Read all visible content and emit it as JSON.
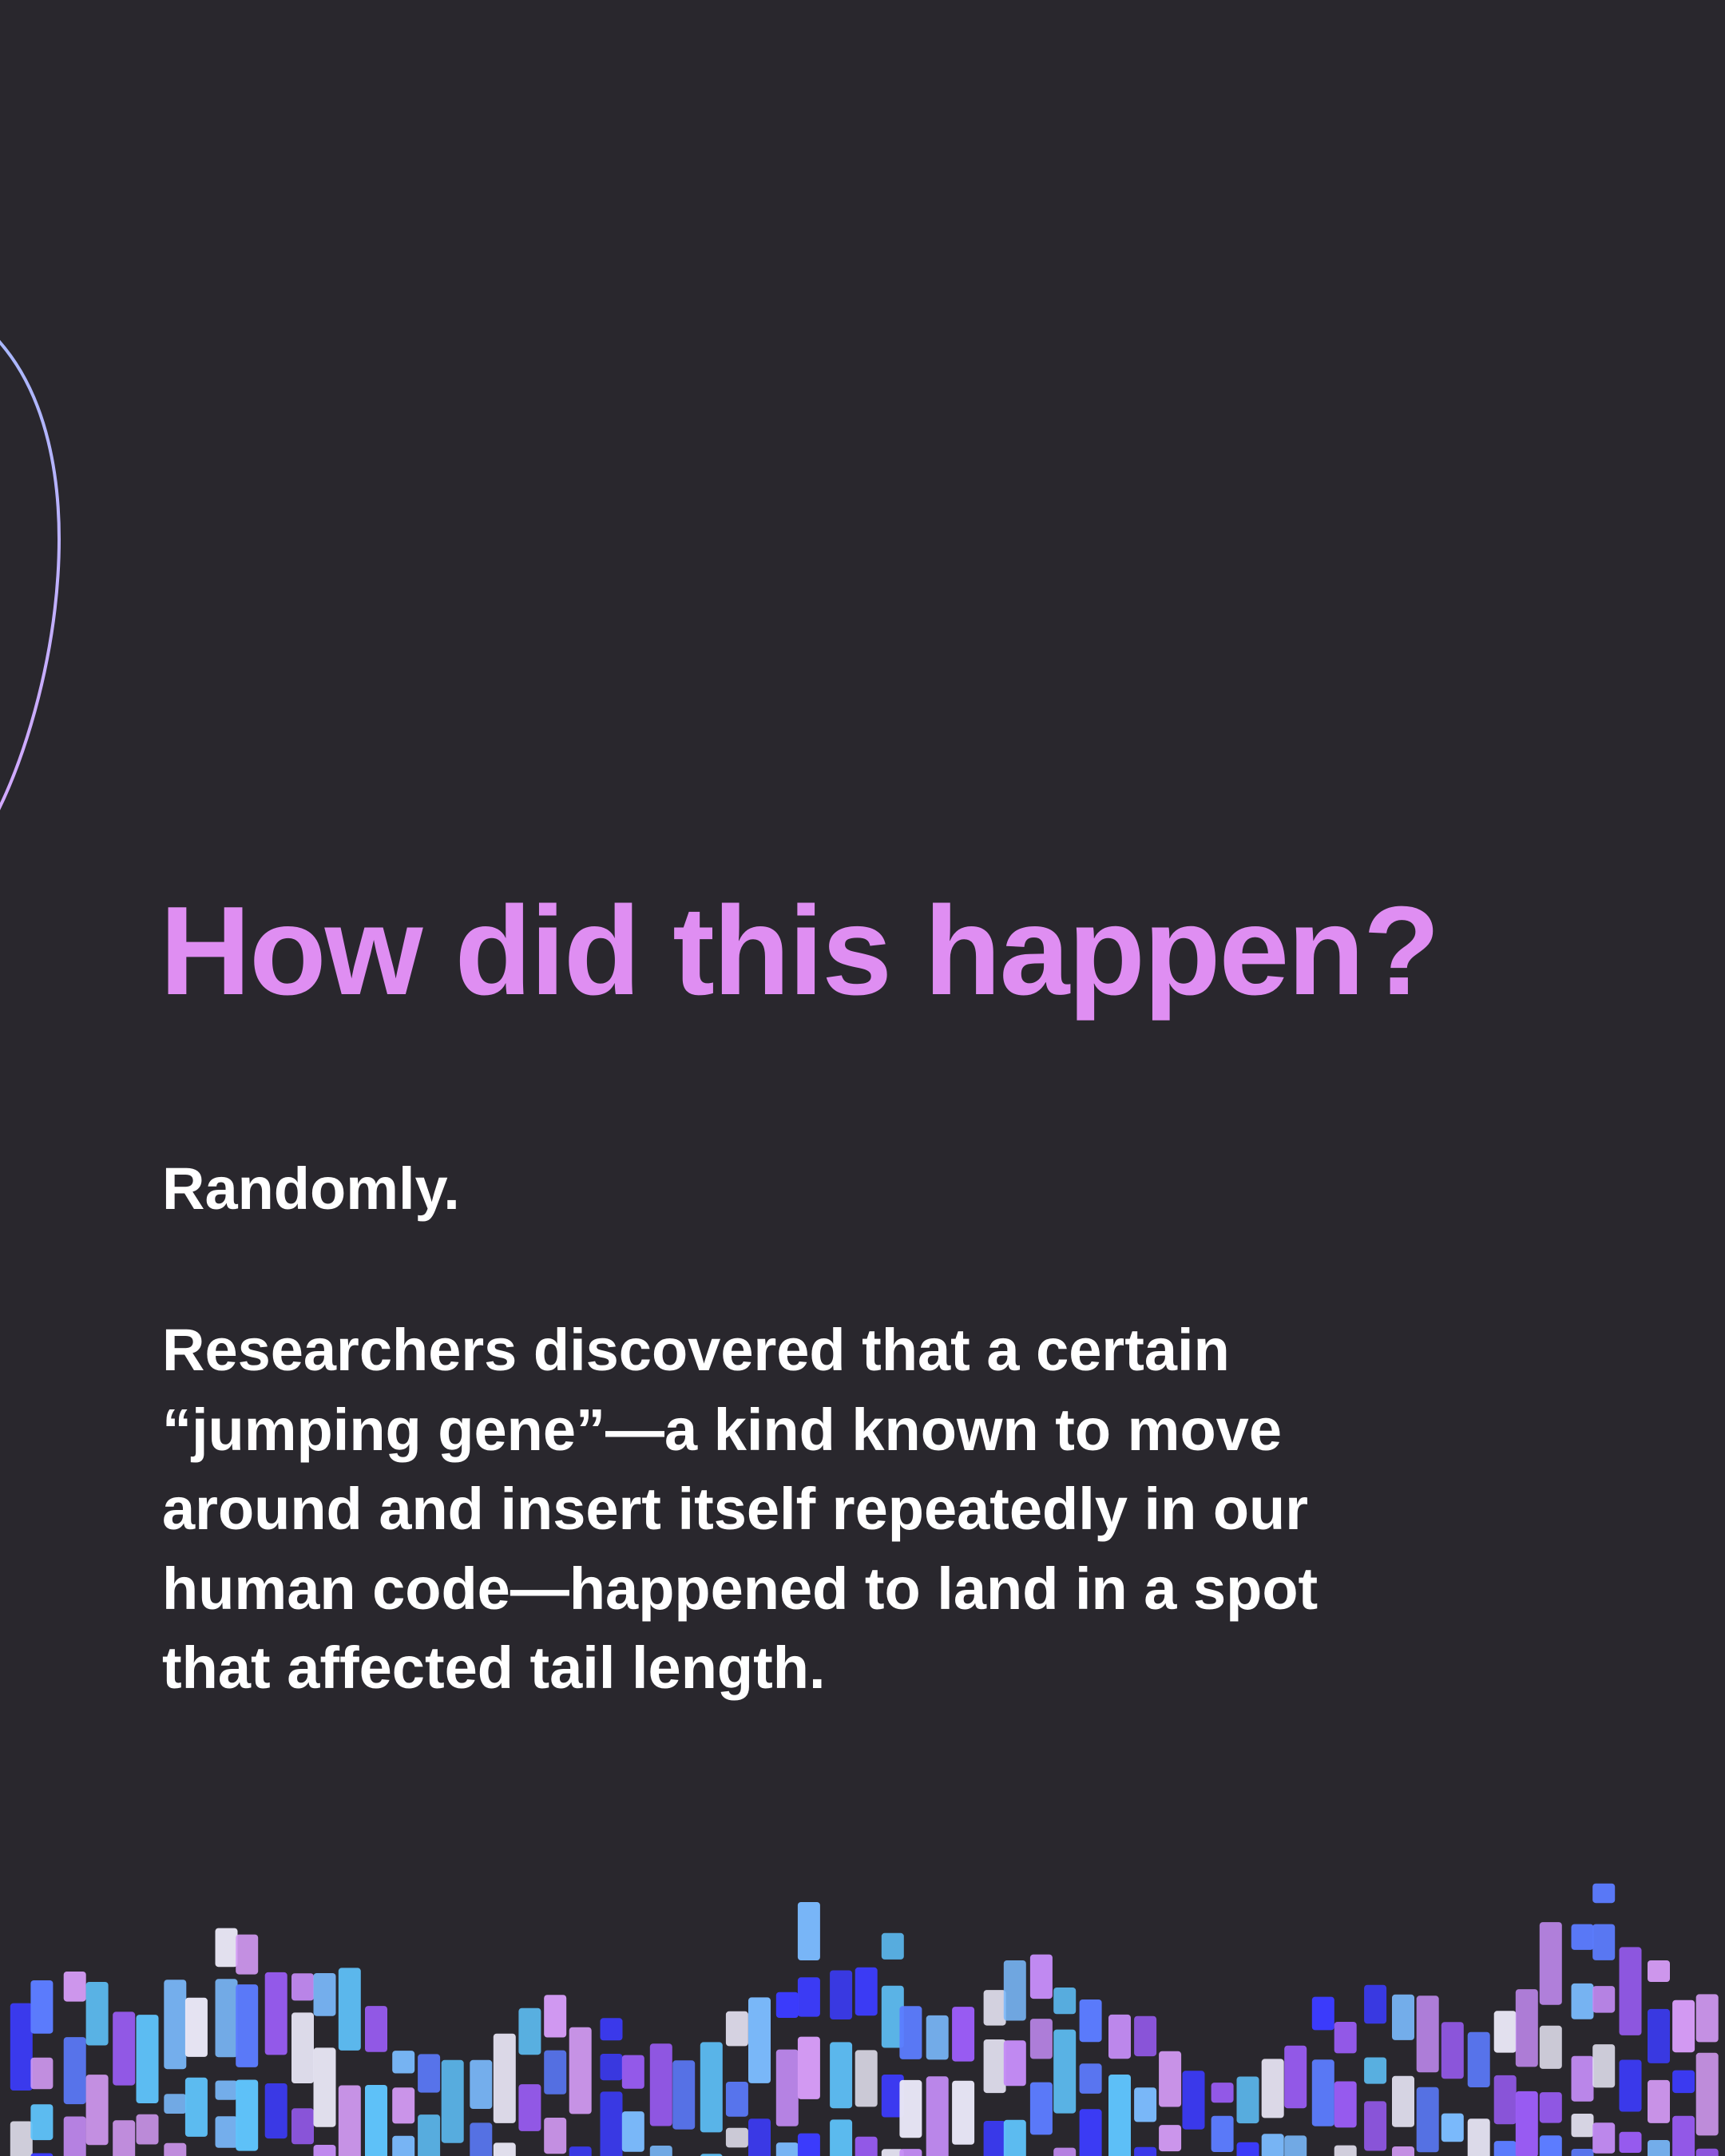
{
  "headline": "How did this happen?",
  "lead": "Randomly.",
  "body_lines": [
    "Researchers discovered that a certain",
    "“jumping gene”—a kind known to move",
    "around and insert itself repeatedly in our",
    "human code—happened to land in a spot",
    "that affected tail length."
  ],
  "colors": {
    "background": "#29272d",
    "headline": "#df8ef2",
    "body": "#ffffff",
    "arc_top": "#a9b8ff",
    "arc_bottom": "#d4a8ff",
    "bar_palette": [
      "#9a5cf5",
      "#5c7cff",
      "#d49bf5",
      "#5fc3fb",
      "#c48cf5",
      "#e8e6f5",
      "#3c3cff",
      "#7ab9fb"
    ]
  }
}
